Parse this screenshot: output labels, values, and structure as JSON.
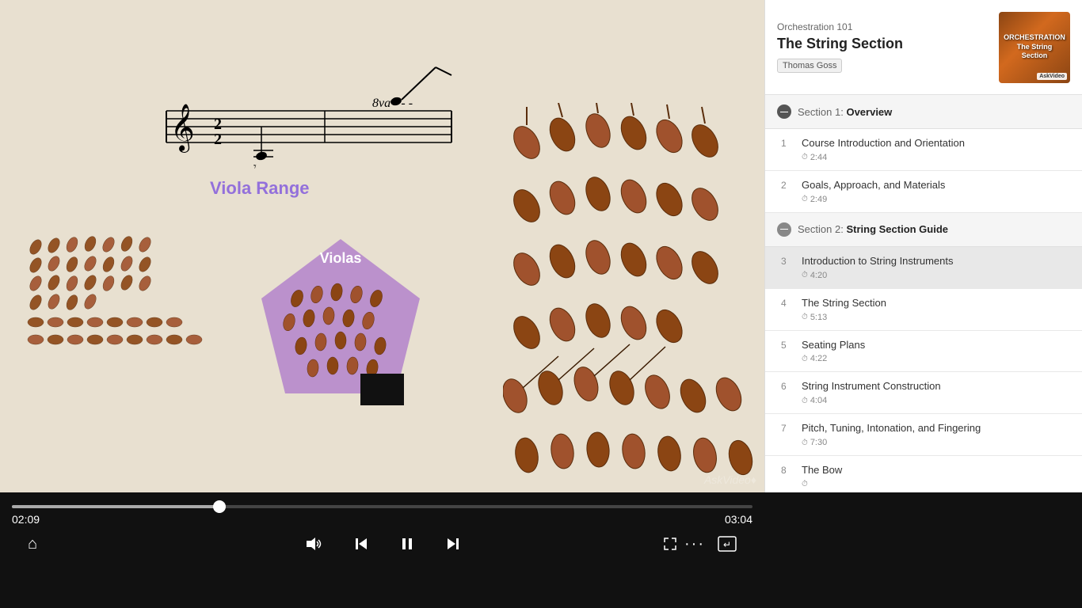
{
  "course": {
    "subtitle": "Orchestration 101",
    "title": "The String Section",
    "author": "Thomas Goss",
    "brand": "AskVideo"
  },
  "sidebar": {
    "section1": {
      "number": "Section 1:",
      "name": "Overview"
    },
    "section2": {
      "number": "Section 2:",
      "name": "String Section Guide"
    },
    "items_section1": [
      {
        "num": "1",
        "title": "Course Introduction and Orientation",
        "time": "2:44"
      },
      {
        "num": "2",
        "title": "Goals, Approach, and Materials",
        "time": "2:49"
      }
    ],
    "items_section2": [
      {
        "num": "3",
        "title": "Introduction to String Instruments",
        "time": "4:20"
      },
      {
        "num": "4",
        "title": "The String Section",
        "time": "5:13"
      },
      {
        "num": "5",
        "title": "Seating Plans",
        "time": "4:22"
      },
      {
        "num": "6",
        "title": "String Instrument Construction",
        "time": "4:04"
      },
      {
        "num": "7",
        "title": "Pitch, Tuning, Intonation, and Fingering",
        "time": "7:30"
      },
      {
        "num": "8",
        "title": "The Bow",
        "time": ""
      }
    ]
  },
  "player": {
    "current_time": "02:09",
    "total_time": "03:04",
    "progress_percent": 28,
    "watermark": "AskVideo♦"
  },
  "scene": {
    "viola_range_label": "Viola Range",
    "violas_label": "Violas"
  },
  "controls": {
    "home": "⌂",
    "volume": "🔊",
    "prev": "⏮",
    "pause": "⏸",
    "next": "⏭",
    "expand": "⤢",
    "more": "···",
    "enter": "↵"
  }
}
